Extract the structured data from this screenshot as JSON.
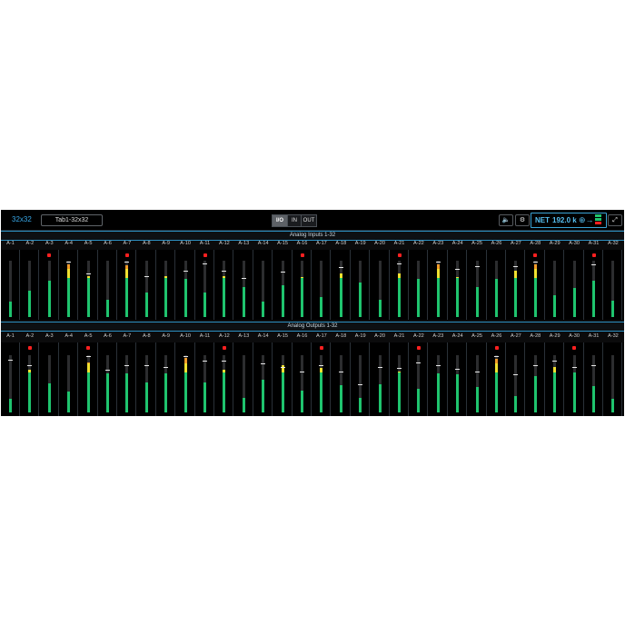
{
  "toolbar": {
    "title": "32x32",
    "tab_label": "Tab1-32x32",
    "seg_io": "I/O",
    "seg_in": "IN",
    "seg_out": "OUT",
    "speaker_icon": "speaker-icon",
    "gear_icon": "gear-icon",
    "net_label": "NET",
    "net_rate": "192.0 k",
    "expand_icon": "expand-icon"
  },
  "sections": {
    "inputs_title": "Analog Inputs 1-32",
    "outputs_title": "Analog Outputs 1-32"
  },
  "channel_labels": [
    "A-1",
    "A-2",
    "A-3",
    "A-4",
    "A-5",
    "A-6",
    "A-7",
    "A-8",
    "A-9",
    "A-10",
    "A-11",
    "A-12",
    "A-13",
    "A-14",
    "A-15",
    "A-16",
    "A-17",
    "A-18",
    "A-19",
    "A-20",
    "A-21",
    "A-22",
    "A-23",
    "A-24",
    "A-25",
    "A-26",
    "A-27",
    "A-28",
    "A-29",
    "A-30",
    "A-31",
    "A-32"
  ],
  "meters": {
    "inputs": {
      "levels": [
        0.27,
        0.47,
        0.65,
        0.94,
        0.72,
        0.3,
        0.92,
        0.44,
        0.73,
        0.68,
        0.44,
        0.72,
        0.53,
        0.28,
        0.56,
        0.71,
        0.36,
        0.78,
        0.61,
        0.3,
        0.78,
        0.68,
        0.93,
        0.71,
        0.53,
        0.67,
        0.83,
        0.93,
        0.38,
        0.52,
        0.65,
        0.29
      ],
      "peaks": [
        null,
        null,
        null,
        0.98,
        0.78,
        null,
        0.98,
        0.73,
        null,
        0.83,
        0.95,
        0.82,
        0.7,
        null,
        0.8,
        null,
        null,
        0.88,
        null,
        null,
        0.95,
        null,
        0.99,
        0.85,
        0.9,
        null,
        0.9,
        0.98,
        null,
        null,
        0.93,
        null
      ],
      "clips": [
        false,
        false,
        true,
        false,
        false,
        false,
        true,
        false,
        false,
        false,
        true,
        false,
        false,
        false,
        false,
        true,
        false,
        false,
        false,
        false,
        true,
        false,
        false,
        false,
        false,
        false,
        false,
        true,
        false,
        false,
        true,
        false
      ]
    },
    "outputs": {
      "levels": [
        0.24,
        0.74,
        0.51,
        0.37,
        0.87,
        0.69,
        0.68,
        0.52,
        0.68,
        0.96,
        0.52,
        0.74,
        0.26,
        0.57,
        0.82,
        0.38,
        0.77,
        0.48,
        0.25,
        0.49,
        0.72,
        0.41,
        0.68,
        0.67,
        0.44,
        0.93,
        0.29,
        0.64,
        0.8,
        0.7,
        0.46,
        0.24
      ],
      "peaks": [
        0.92,
        0.83,
        null,
        null,
        0.98,
        0.75,
        0.82,
        0.82,
        0.79,
        0.98,
        0.9,
        0.9,
        null,
        0.85,
        0.79,
        0.72,
        0.82,
        0.72,
        0.5,
        0.8,
        0.78,
        0.88,
        0.82,
        0.76,
        0.72,
        0.98,
        0.66,
        0.82,
        0.9,
        0.8,
        0.82,
        null
      ],
      "clips": [
        false,
        true,
        false,
        false,
        true,
        false,
        false,
        false,
        false,
        false,
        false,
        true,
        false,
        false,
        false,
        false,
        true,
        false,
        false,
        false,
        false,
        true,
        false,
        false,
        false,
        true,
        false,
        false,
        false,
        true,
        false,
        false
      ]
    }
  },
  "colors": {
    "green": "#1fc46e",
    "yellow": "#f0e030",
    "orange": "#f09a28",
    "clip": "#ff2020",
    "accent": "#38a8e8"
  }
}
